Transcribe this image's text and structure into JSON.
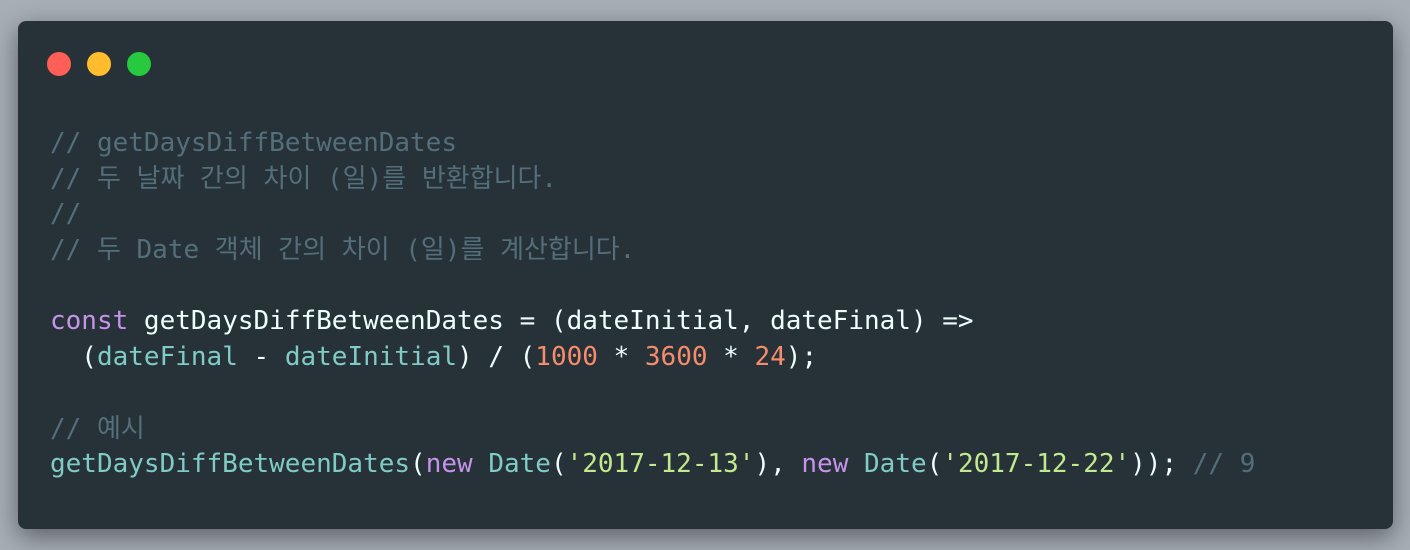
{
  "colors": {
    "background": "#263238",
    "comment": "#546e7a",
    "keyword": "#c792ea",
    "plain": "#eeffff",
    "param": "#80cbc4",
    "number": "#f78c6c",
    "string": "#c3e88d",
    "operator": "#89ddff",
    "window_red": "#ff5f56",
    "window_yellow": "#ffbd2e",
    "window_green": "#27c93f"
  },
  "window": {
    "controls": [
      "close",
      "minimize",
      "maximize"
    ]
  },
  "code_lines": [
    [
      {
        "t": "// getDaysDiffBetweenDates",
        "c": "comment"
      }
    ],
    [
      {
        "t": "// 두 날짜 간의 차이 (일)를 반환합니다.",
        "c": "comment"
      }
    ],
    [
      {
        "t": "//",
        "c": "comment"
      }
    ],
    [
      {
        "t": "// 두 Date 객체 간의 차이 (일)를 계산합니다.",
        "c": "comment"
      }
    ],
    [],
    [
      {
        "t": "const",
        "c": "keyword"
      },
      {
        "t": " getDaysDiffBetweenDates = (dateInitial, dateFinal) =>",
        "c": "plain"
      }
    ],
    [
      {
        "t": "  (",
        "c": "plain"
      },
      {
        "t": "dateFinal",
        "c": "param"
      },
      {
        "t": " - ",
        "c": "plain"
      },
      {
        "t": "dateInitial",
        "c": "param"
      },
      {
        "t": ") / (",
        "c": "plain"
      },
      {
        "t": "1000",
        "c": "number"
      },
      {
        "t": " * ",
        "c": "plain"
      },
      {
        "t": "3600",
        "c": "number"
      },
      {
        "t": " * ",
        "c": "plain"
      },
      {
        "t": "24",
        "c": "number"
      },
      {
        "t": ");",
        "c": "plain"
      }
    ],
    [],
    [
      {
        "t": "// 예시",
        "c": "comment"
      }
    ],
    [
      {
        "t": "getDaysDiffBetweenDates",
        "c": "param"
      },
      {
        "t": "(",
        "c": "plain"
      },
      {
        "t": "new",
        "c": "keyword"
      },
      {
        "t": " ",
        "c": "plain"
      },
      {
        "t": "Date",
        "c": "param"
      },
      {
        "t": "(",
        "c": "plain"
      },
      {
        "t": "'2017-12-13'",
        "c": "string"
      },
      {
        "t": "), ",
        "c": "plain"
      },
      {
        "t": "new",
        "c": "keyword"
      },
      {
        "t": " ",
        "c": "plain"
      },
      {
        "t": "Date",
        "c": "param"
      },
      {
        "t": "(",
        "c": "plain"
      },
      {
        "t": "'2017-12-22'",
        "c": "string"
      },
      {
        "t": ")); ",
        "c": "plain"
      },
      {
        "t": "// 9",
        "c": "comment"
      }
    ]
  ]
}
